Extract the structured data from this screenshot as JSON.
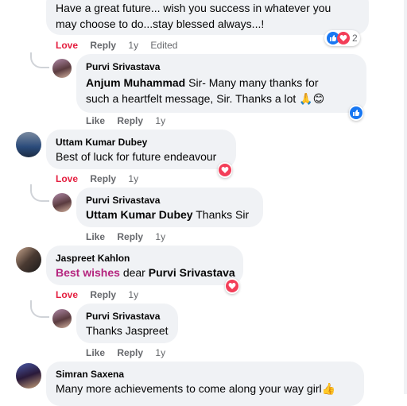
{
  "top_comment": {
    "line1": "Have a great future... wish you success in whatever you",
    "line2": "may choose to do...stay blessed always...!",
    "reaction_count": "2",
    "actions": {
      "love": "Love",
      "reply": "Reply",
      "time": "1y",
      "edited": "Edited"
    }
  },
  "comments": [
    {
      "author": "Purvi Srivastava",
      "mention": "Anjum Muhammad",
      "text_line1": " Sir- Many many thanks for",
      "text_line2": "such a heartfelt message, Sir. Thanks a lot 🙏😊",
      "actions": {
        "like": "Like",
        "reply": "Reply",
        "time": "1y"
      }
    },
    {
      "author": "Uttam Kumar Dubey",
      "text": "Best of luck for future endeavour",
      "actions": {
        "love": "Love",
        "reply": "Reply",
        "time": "1y"
      }
    },
    {
      "author": "Purvi Srivastava",
      "mention": "Uttam Kumar Dubey",
      "text": " Thanks Sir",
      "actions": {
        "like": "Like",
        "reply": "Reply",
        "time": "1y"
      }
    },
    {
      "author": "Jaspreet Kahlon",
      "highlight": "Best wishes",
      "text": " dear ",
      "mention": "Purvi Srivastava",
      "actions": {
        "love": "Love",
        "reply": "Reply",
        "time": "1y"
      }
    },
    {
      "author": "Purvi Srivastava",
      "text": "Thanks Jaspreet",
      "actions": {
        "like": "Like",
        "reply": "Reply",
        "time": "1y"
      }
    },
    {
      "author": "Simran Saxena",
      "text": "Many more achievements to come along your way girl👍"
    }
  ],
  "icons": {
    "like": "like-icon",
    "love": "love-icon"
  },
  "colors": {
    "bubble": "#f0f2f5",
    "love": "#e41e3f",
    "like": "#1877f2",
    "highlight": "#b5247e",
    "meta": "#65676b"
  }
}
